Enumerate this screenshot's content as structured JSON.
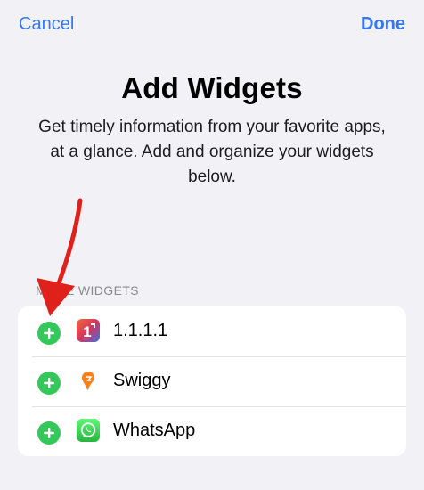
{
  "nav": {
    "cancel_label": "Cancel",
    "done_label": "Done"
  },
  "header": {
    "title": "Add Widgets",
    "subtitle": "Get timely information from your favorite apps, at a glance. Add and organize your widgets below."
  },
  "section": {
    "label": "MORE WIDGETS"
  },
  "widgets": [
    {
      "name": "1.1.1.1",
      "icon": "cloudflare-warp-icon"
    },
    {
      "name": "Swiggy",
      "icon": "swiggy-icon"
    },
    {
      "name": "WhatsApp",
      "icon": "whatsapp-icon"
    }
  ],
  "colors": {
    "accent": "#3478f6",
    "add_button": "#34c759",
    "background": "#f2f2f6",
    "annotation_arrow": "#e0201b"
  }
}
